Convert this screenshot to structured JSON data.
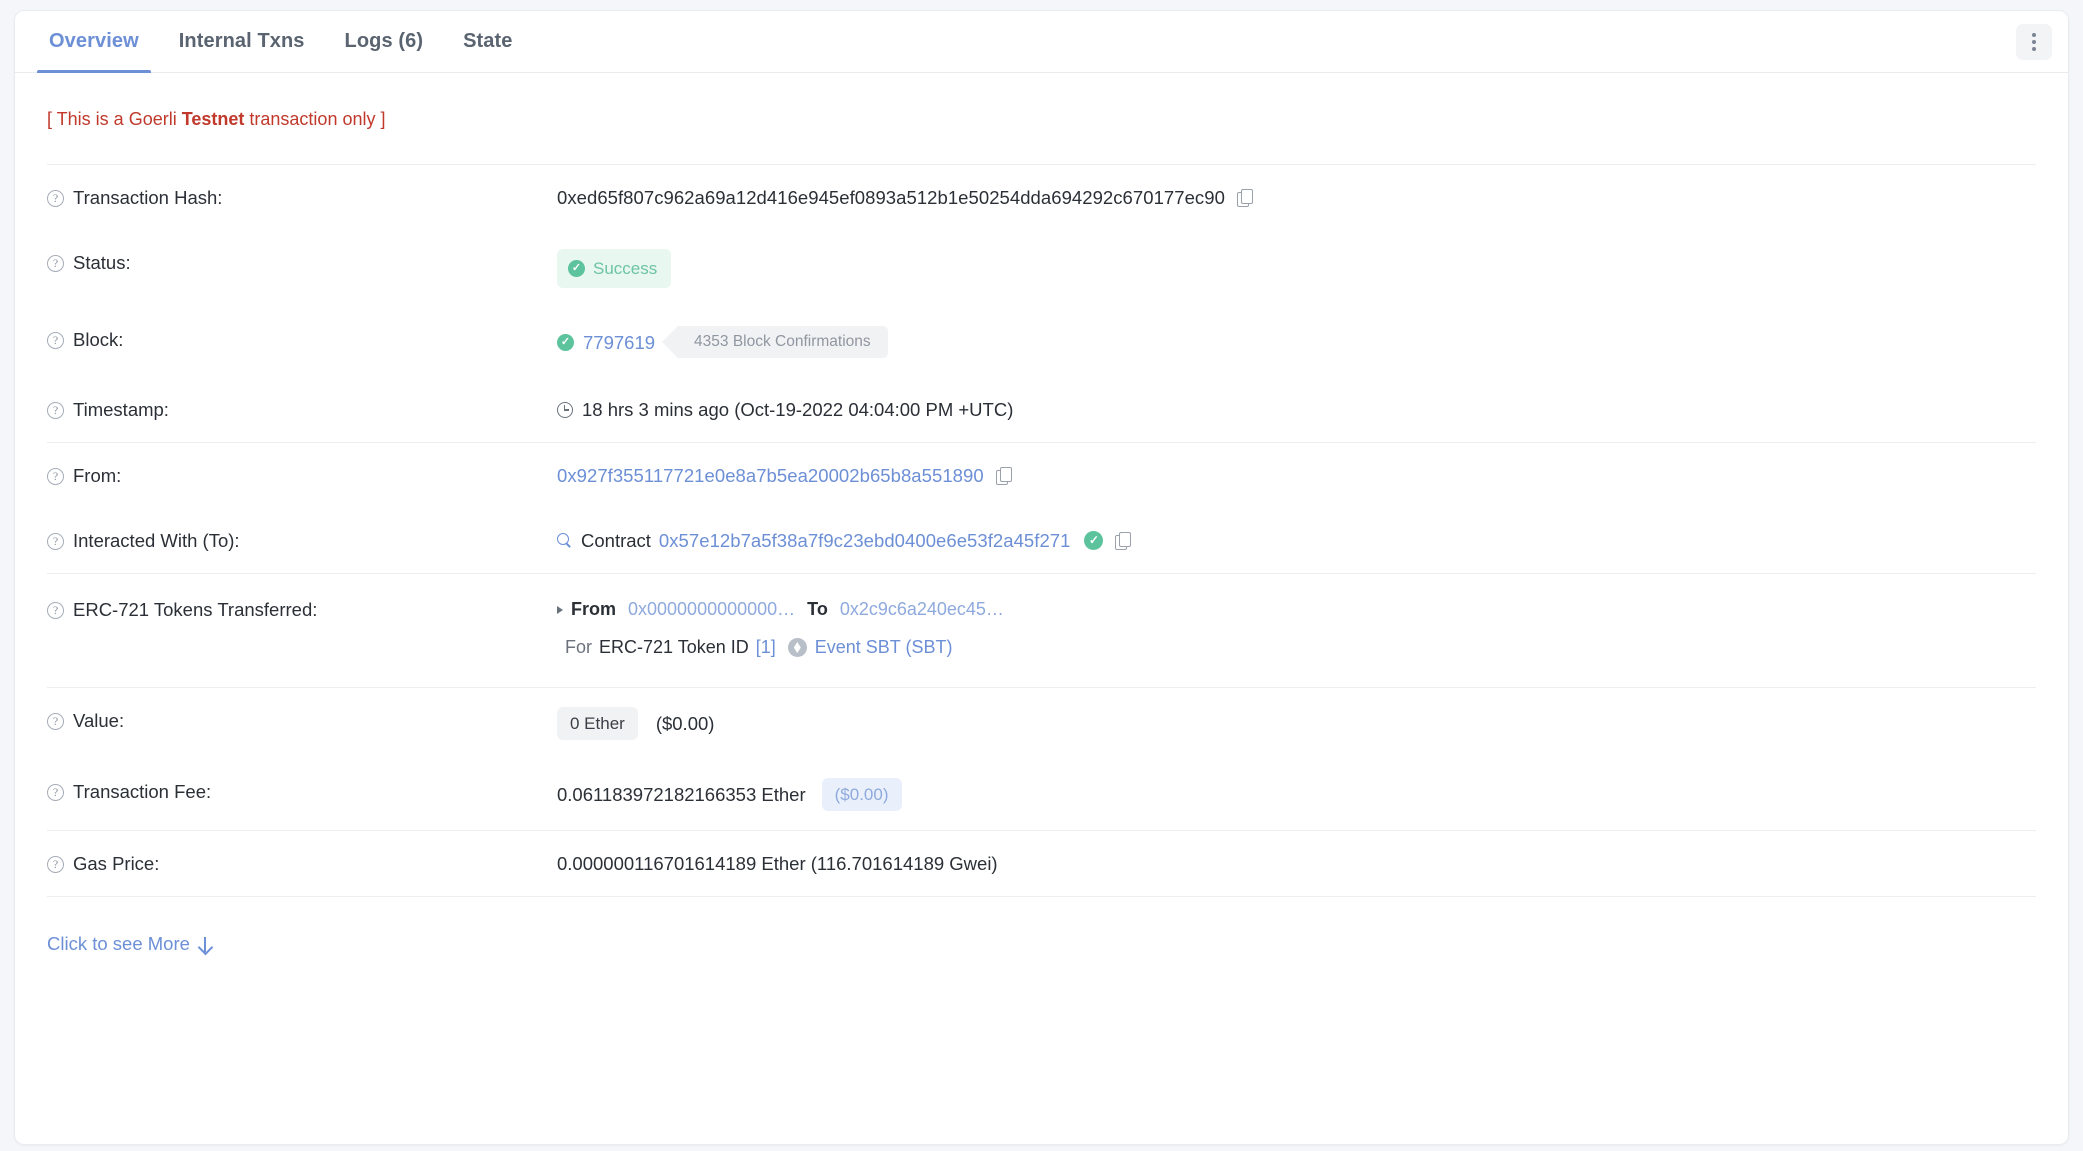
{
  "tabs": [
    {
      "label": "Overview",
      "active": true
    },
    {
      "label": "Internal Txns",
      "active": false
    },
    {
      "label": "Logs (6)",
      "active": false
    },
    {
      "label": "State",
      "active": false
    }
  ],
  "menu": {
    "icon": "kebab-menu-icon"
  },
  "notice": {
    "prefix": "[ This is a Goerli ",
    "strong": "Testnet",
    "suffix": " transaction only ]"
  },
  "rows": {
    "transaction_hash": {
      "label": "Transaction Hash:",
      "value": "0xed65f807c962a69a12d416e945ef0893a512b1e50254dda694292c670177ec90"
    },
    "status": {
      "label": "Status:",
      "value": "Success"
    },
    "block": {
      "label": "Block:",
      "number": "7797619",
      "confirmations": "4353 Block Confirmations"
    },
    "timestamp": {
      "label": "Timestamp:",
      "value": "18 hrs 3 mins ago (Oct-19-2022 04:04:00 PM +UTC)"
    },
    "from": {
      "label": "From:",
      "value": "0x927f355117721e0e8a7b5ea20002b65b8a551890"
    },
    "interacted_with": {
      "label": "Interacted With (To):",
      "prefix": "Contract",
      "address": "0x57e12b7a5f38a7f9c23ebd0400e6e53f2a45f271"
    },
    "erc721": {
      "label": "ERC-721 Tokens Transferred:",
      "from_label": "From",
      "from_address": "0x0000000000000…",
      "to_label": "To",
      "to_address": "0x2c9c6a240ec45…",
      "for_label": "For",
      "token_text": "ERC-721 Token ID",
      "token_id": "[1]",
      "token_name": "Event SBT (SBT)"
    },
    "value": {
      "label": "Value:",
      "amount": "0 Ether",
      "usd": "($0.00)"
    },
    "transaction_fee": {
      "label": "Transaction Fee:",
      "amount": "0.061183972182166353 Ether",
      "usd": "($0.00)"
    },
    "gas_price": {
      "label": "Gas Price:",
      "value": "0.000000116701614189 Ether (116.701614189 Gwei)"
    }
  },
  "footer": {
    "see_more": "Click to see More"
  },
  "colors": {
    "accent_blue": "#6c8fd6",
    "success_green": "#5cc39c",
    "testnet_red": "#c0392b",
    "muted_gray": "#9097a1"
  }
}
